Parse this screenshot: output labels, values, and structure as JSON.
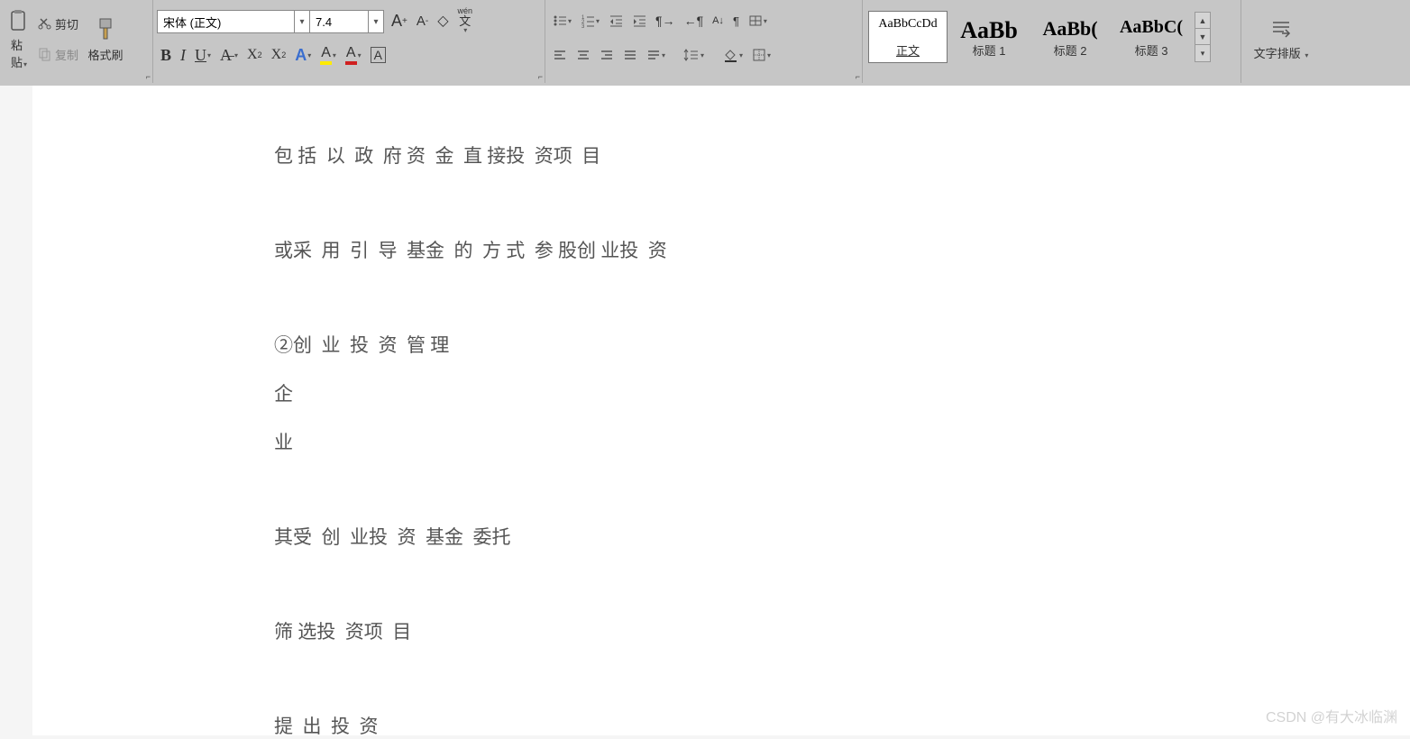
{
  "ribbon": {
    "clipboard": {
      "cut": "剪切",
      "copy": "复制",
      "paste": "粘",
      "paste2": "贴",
      "format_painter": "格式刷"
    },
    "font": {
      "name": "宋体 (正文)",
      "size": "7.4",
      "bold": "B",
      "italic": "I",
      "underline": "U",
      "increase": "A",
      "decrease": "A",
      "clear_format": "◇",
      "phonetic": "wén",
      "superscript": "X",
      "superscript_mark": "2",
      "subscript": "X",
      "subscript_mark": "2",
      "font_effects": "A",
      "highlight": "A",
      "font_color": "A",
      "char_border": "A"
    },
    "paragraph": {
      "bullets": "•",
      "numbers": "1",
      "multilevel": "≡",
      "dec_indent": "←",
      "inc_indent": "→",
      "ltr_dir": "¶",
      "rtl_dir": "¶",
      "tab_stops": "⊞",
      "sort": "A↓",
      "align_left": "",
      "align_center": "",
      "align_right": "",
      "justify": "",
      "distribute": "",
      "line_spacing": "↕",
      "shading": "⬛",
      "border": "⊞"
    },
    "styles": [
      {
        "preview": "AaBbCcDd",
        "label": "正文",
        "selected": true,
        "size": 14,
        "underline": true
      },
      {
        "preview": "AaBb",
        "label": "标题 1",
        "selected": false,
        "size": 26,
        "bold": true
      },
      {
        "preview": "AaBb(",
        "label": "标题 2",
        "selected": false,
        "size": 22,
        "bold": true
      },
      {
        "preview": "AaBbC(",
        "label": "标题 3",
        "selected": false,
        "size": 20,
        "bold": true
      }
    ],
    "typeset": "文字排版"
  },
  "document": {
    "lines": [
      "包 括  以  政  府 资  金  直 接投  资项  目",
      "或采  用  引  导  基金  的  方 式  参 股创 业投  资",
      "②创  业  投  资  管 理",
      "企",
      "业",
      "其受  创  业投  资  基金  委托",
      "筛 选投  资项  目",
      "提  出  投  资"
    ]
  },
  "watermark": "CSDN @有大冰临渊"
}
